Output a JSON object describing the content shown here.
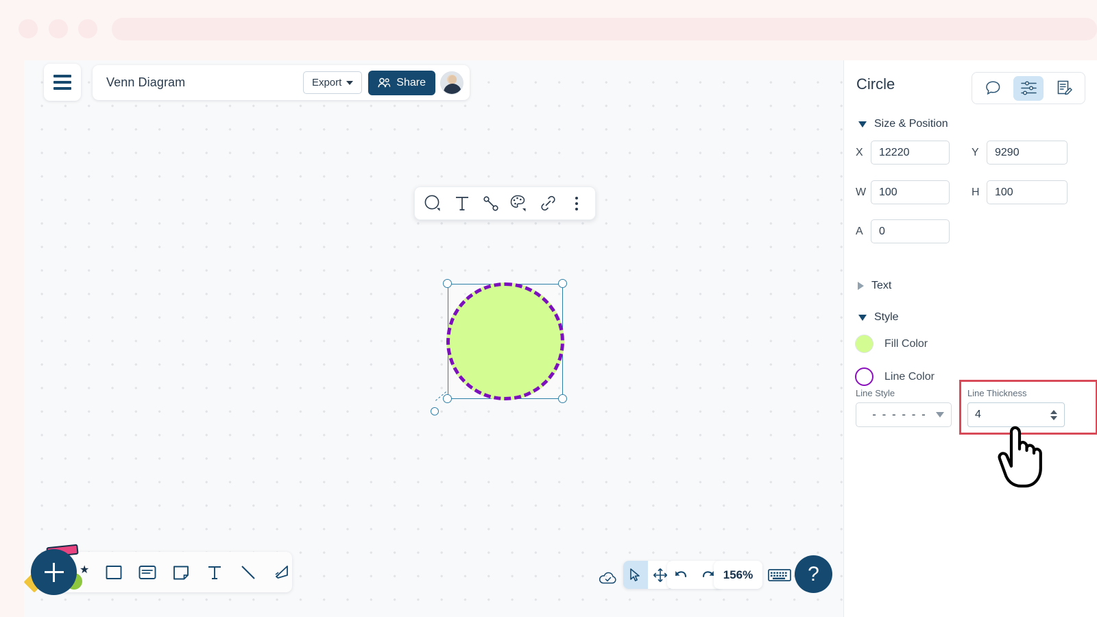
{
  "window": {
    "chrome_dots": [
      "dot-1",
      "dot-2",
      "dot-3"
    ]
  },
  "toolbar": {
    "menu_icon": "hamburger-icon",
    "doc_title": "Venn Diagram",
    "export_label": "Export",
    "share_label": "Share",
    "avatar_icon": "user-avatar"
  },
  "context_toolbar": {
    "items": [
      {
        "name": "shape-tool",
        "icon": "circle-icon"
      },
      {
        "name": "text-tool",
        "icon": "text-icon"
      },
      {
        "name": "connector-tool",
        "icon": "line-connector-icon"
      },
      {
        "name": "style-tool",
        "icon": "palette-icon"
      },
      {
        "name": "link-tool",
        "icon": "link-icon"
      },
      {
        "name": "more-tool",
        "icon": "more-vertical-icon"
      }
    ]
  },
  "canvas": {
    "shape": {
      "type": "circle",
      "fill_color": "#d3fc92",
      "line_color": "#7d10bd",
      "line_style": "dashed",
      "line_thickness": 4,
      "selected": true
    }
  },
  "tool_bar": {
    "add_label": "+",
    "items": [
      {
        "name": "rectangle-tool",
        "icon": "square-icon"
      },
      {
        "name": "card-tool",
        "icon": "card-icon"
      },
      {
        "name": "sticky-note-tool",
        "icon": "sticky-note-icon"
      },
      {
        "name": "text-tool",
        "icon": "text-icon"
      },
      {
        "name": "line-tool",
        "icon": "diagonal-line-icon"
      },
      {
        "name": "freehand-tool",
        "icon": "pen-icon"
      }
    ]
  },
  "status_bar": {
    "cloud_icon": "cloud-check-icon",
    "select_mode_icon": "cursor-arrow-icon",
    "pan_mode_icon": "move-arrows-icon",
    "undo_icon": "undo-arrow-icon",
    "redo_icon": "redo-arrow-icon",
    "zoom_level": "156%",
    "keyboard_icon": "keyboard-icon",
    "help_label": "?"
  },
  "panel": {
    "title": "Circle",
    "tabs": [
      {
        "name": "comments-tab",
        "icon": "comment-bubble-icon",
        "active": false
      },
      {
        "name": "properties-tab",
        "icon": "sliders-icon",
        "active": true
      },
      {
        "name": "notes-tab",
        "icon": "document-edit-icon",
        "active": false
      }
    ],
    "sections": {
      "size_position": {
        "label": "Size & Position",
        "expanded": true,
        "fields": {
          "x_label": "X",
          "x_value": "12220",
          "y_label": "Y",
          "y_value": "9290",
          "w_label": "W",
          "w_value": "100",
          "h_label": "H",
          "h_value": "100",
          "a_label": "A",
          "a_value": "0"
        }
      },
      "text": {
        "label": "Text",
        "expanded": false
      },
      "style": {
        "label": "Style",
        "expanded": true,
        "fill_color_label": "Fill Color",
        "fill_color_value": "#d3fc92",
        "line_color_label": "Line Color",
        "line_color_value": "#8a10bd",
        "line_style_label": "Line Style",
        "line_style_value": "- - - - - -",
        "line_thickness_label": "Line Thickness",
        "line_thickness_value": "4"
      }
    }
  },
  "highlight": {
    "color": "#d94a58",
    "target": "line-thickness-field"
  }
}
